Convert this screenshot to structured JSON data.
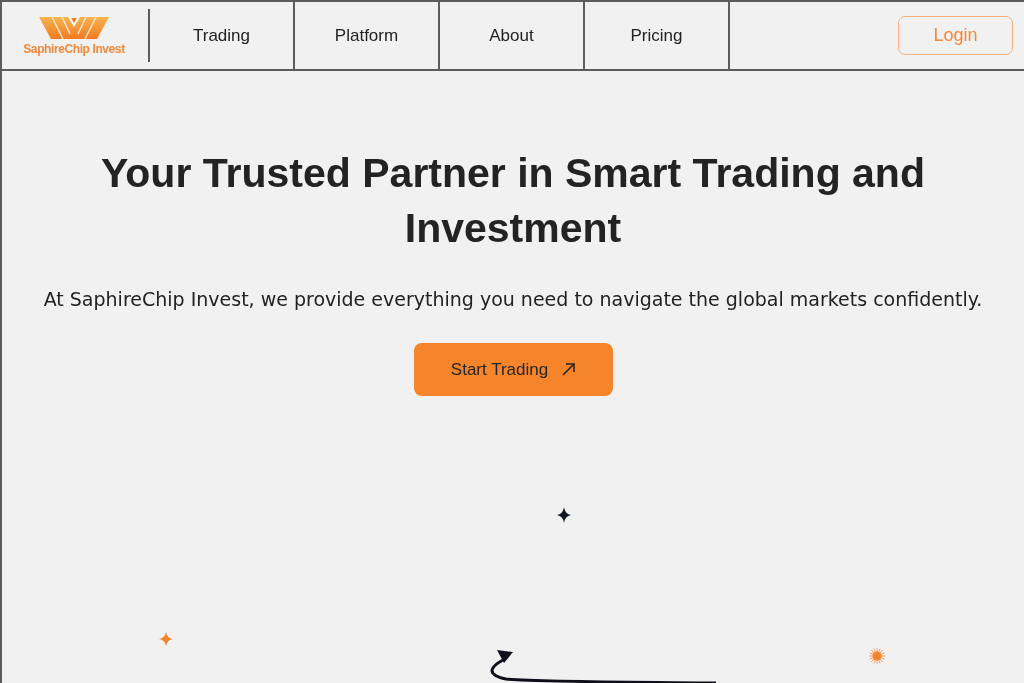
{
  "brand": {
    "name": "SaphireChip Invest"
  },
  "nav": {
    "links": [
      "Trading",
      "Platform",
      "About",
      "Pricing"
    ],
    "login": "Login"
  },
  "hero": {
    "title": "Your Trusted Partner in Smart Trading and Investment",
    "subtitle": "At SaphireChip Invest, we provide everything you need to navigate the global markets confidently.",
    "cta": "Start Trading"
  }
}
